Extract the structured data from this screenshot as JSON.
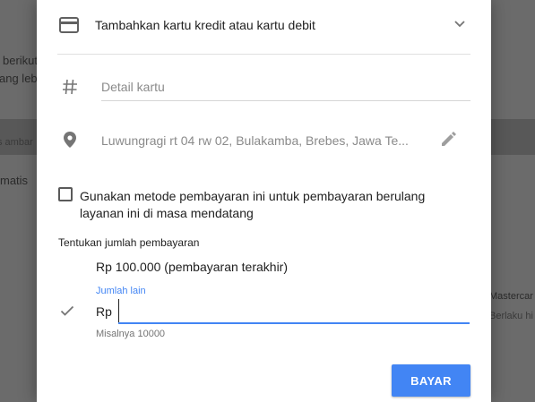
{
  "background": {
    "left_texts": [
      "berikut",
      "ang lebi",
      "s ambar",
      "matis"
    ],
    "right_texts": [
      "Mastercar",
      "Berlaku hi"
    ]
  },
  "dialog": {
    "card_type": {
      "title": "Tambahkan kartu kredit atau kartu debit",
      "icon": "credit-card-icon"
    },
    "card_details": {
      "placeholder": "Detail kartu",
      "icon": "hash-icon"
    },
    "address": {
      "value": "Luwungragi rt 04 rw 02, Bulakamba, Brebes, Jawa Te...",
      "icon": "location-pin-icon",
      "edit_icon": "pencil-icon"
    },
    "recurring_checkbox": {
      "label": "Gunakan metode pembayaran ini untuk pembayaran berulang layanan ini di masa mendatang",
      "checked": false
    },
    "payment_amount": {
      "section_title": "Tentukan jumlah pembayaran",
      "last_payment_option": "Rp 100.000 (pembayaran terakhir)",
      "other_amount_label": "Jumlah lain",
      "currency_prefix": "Rp",
      "input_value": "",
      "hint": "Misalnya 10000"
    },
    "pay_button": "BAYAR"
  },
  "colors": {
    "accent": "#4285f4",
    "text": "#212121",
    "muted": "#8a8a8a"
  }
}
